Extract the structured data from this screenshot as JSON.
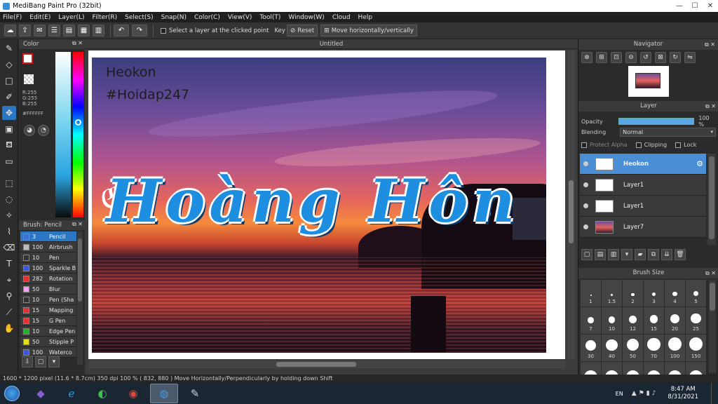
{
  "window": {
    "title": "MediBang Paint Pro (32bit)"
  },
  "menu": [
    "File(F)",
    "Edit(E)",
    "Layer(L)",
    "Filter(R)",
    "Select(S)",
    "Snap(N)",
    "Color(C)",
    "View(V)",
    "Tool(T)",
    "Window(W)",
    "Cloud",
    "Help"
  ],
  "toolbar": {
    "select_layer_label": "Select a layer at the clicked point",
    "key_label": "Key",
    "reset_label": "Reset",
    "move_label": "Move horizontally/vertically"
  },
  "color_panel": {
    "title": "Color",
    "rgb": [
      "R:255",
      "G:255",
      "B:255"
    ],
    "hex": "#FFFFFF",
    "fg_color": "#d41a1a"
  },
  "brush_panel": {
    "title": "Brush: Pencil",
    "brushes": [
      {
        "size": "3",
        "name": "Pencil",
        "color": "#3a6fd0",
        "selected": true
      },
      {
        "size": "100",
        "name": "Airbrush",
        "color": "#bbbbbb"
      },
      {
        "size": "10",
        "name": "Pen",
        "color": "#333333"
      },
      {
        "size": "100",
        "name": "Sparkle B",
        "color": "#3a55e0"
      },
      {
        "size": "282",
        "name": "Rotation",
        "color": "#e03030"
      },
      {
        "size": "50",
        "name": "Blur",
        "color": "#f0a0f0"
      },
      {
        "size": "10",
        "name": "Pen (Sha",
        "color": "#333333"
      },
      {
        "size": "15",
        "name": "Mapping",
        "color": "#e03030"
      },
      {
        "size": "15",
        "name": "G Pen",
        "color": "#e03030"
      },
      {
        "size": "10",
        "name": "Edge Pen",
        "color": "#20b020"
      },
      {
        "size": "50",
        "name": "Stipple P",
        "color": "#e0e020"
      },
      {
        "size": "100",
        "name": "Waterco",
        "color": "#3a55e0"
      }
    ]
  },
  "document": {
    "tab": "Untitled",
    "watermark_line1": "Heokon",
    "watermark_line2": "#Hoidap247",
    "main_text": "Hoàng Hôn"
  },
  "navigator": {
    "title": "Navigator"
  },
  "layer_panel": {
    "title": "Layer",
    "opacity_label": "Opacity",
    "opacity_value": "100 %",
    "opacity": 1.0,
    "blending_label": "Blending",
    "blending_value": "Normal",
    "protect_alpha": "Protect Alpha",
    "clipping": "Clipping",
    "lock": "Lock",
    "layers": [
      {
        "name": "Heokon",
        "selected": true
      },
      {
        "name": "Layer1"
      },
      {
        "name": "Layer1"
      },
      {
        "name": "Layer7"
      }
    ]
  },
  "brush_size": {
    "title": "Brush Size",
    "sizes": [
      "1",
      "1.5",
      "2",
      "3",
      "4",
      "5",
      "7",
      "10",
      "12",
      "15",
      "20",
      "25",
      "30",
      "40",
      "50",
      "70",
      "100",
      "150",
      "",
      "",
      "",
      "",
      "",
      ""
    ]
  },
  "status": {
    "text": "1600 * 1200 pixel   (11.6 * 8.7cm)   350 dpi   100 %   ( 832, 880 )   Move Horizontally/Perpendicularly by holding down Shift"
  },
  "taskbar": {
    "lang": "EN",
    "time": "8:47 AM",
    "date": "8/31/2021"
  }
}
